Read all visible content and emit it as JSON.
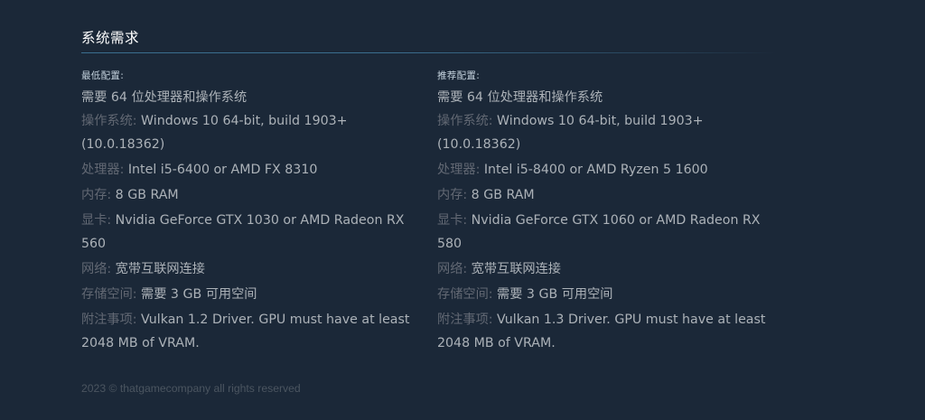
{
  "section": {
    "title": "系统需求"
  },
  "minimum": {
    "heading": "最低配置:",
    "requires": "需要 64 位处理器和操作系统",
    "os": {
      "label": "操作系统:",
      "value": "Windows 10 64-bit, build 1903+ (10.0.18362)"
    },
    "cpu": {
      "label": "处理器:",
      "value": "Intel i5-6400 or AMD FX 8310"
    },
    "memory": {
      "label": "内存:",
      "value": "8 GB RAM"
    },
    "gpu": {
      "label": "显卡:",
      "value": "Nvidia GeForce GTX 1030 or AMD Radeon RX 560"
    },
    "network": {
      "label": "网络:",
      "value": "宽带互联网连接"
    },
    "storage": {
      "label": "存储空间:",
      "value": "需要 3 GB 可用空间"
    },
    "notes": {
      "label": "附注事项:",
      "value": "Vulkan 1.2 Driver. GPU must have at least 2048 MB of VRAM."
    }
  },
  "recommended": {
    "heading": "推荐配置:",
    "requires": "需要 64 位处理器和操作系统",
    "os": {
      "label": "操作系统:",
      "value": "Windows 10 64-bit, build 1903+ (10.0.18362)"
    },
    "cpu": {
      "label": "处理器:",
      "value": "Intel i5-8400 or AMD Ryzen 5 1600"
    },
    "memory": {
      "label": "内存:",
      "value": "8 GB RAM"
    },
    "gpu": {
      "label": "显卡:",
      "value": "Nvidia GeForce GTX 1060 or AMD Radeon RX 580"
    },
    "network": {
      "label": "网络:",
      "value": "宽带互联网连接"
    },
    "storage": {
      "label": "存储空间:",
      "value": "需要 3 GB 可用空间"
    },
    "notes": {
      "label": "附注事项:",
      "value": "Vulkan 1.3 Driver. GPU must have at least 2048 MB of VRAM."
    }
  },
  "footer": {
    "copyright": "2023 © thatgamecompany all rights reserved"
  },
  "colors": {
    "background": "#1b2838",
    "title": "#ffffff",
    "value_text": "#acb2b8",
    "label_text": "#626873",
    "rule": "#3b6e8f",
    "footer_text": "#4b5560"
  }
}
